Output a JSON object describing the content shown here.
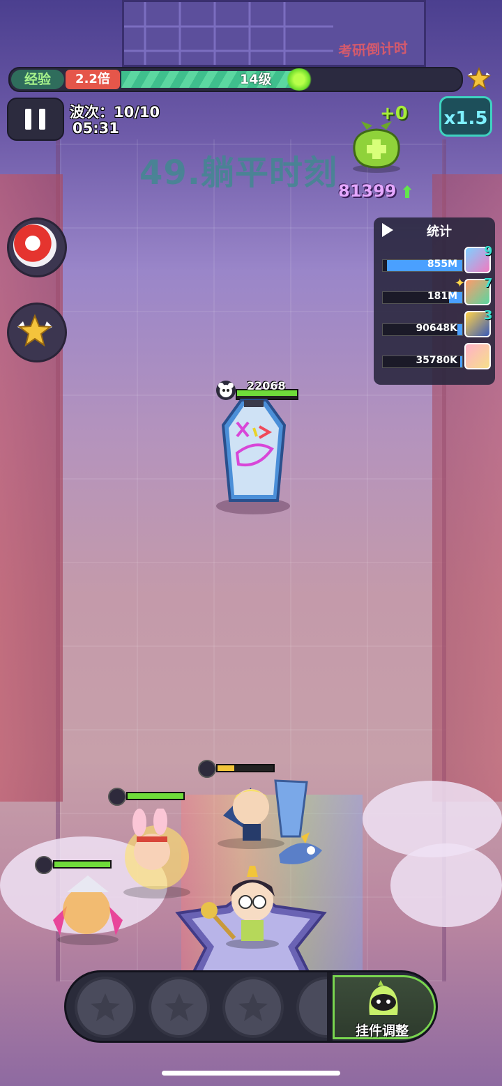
{
  "exp": {
    "label": "经验",
    "multiplier": "2.2倍",
    "level": "14级",
    "progress": 0.45
  },
  "wave": {
    "label": "波次：10/10",
    "time": "05:31"
  },
  "speed": {
    "label": "x1.5"
  },
  "reward": {
    "plus": "+0",
    "gold": "81399"
  },
  "stage_title": "49.躺平时刻",
  "board_text": "考研倒计时",
  "stats": {
    "title": "统计",
    "rows": [
      {
        "value": "855M",
        "count": "9",
        "fill": 0.95,
        "color": "#4aa0ff"
      },
      {
        "value": "181M",
        "count": "7",
        "fill": 0.17,
        "color": "#4aa0ff"
      },
      {
        "value": "90648K",
        "count": "3",
        "fill": 0.06,
        "color": "#4aa0ff"
      },
      {
        "value": "35780K",
        "count": "",
        "fill": 0.03,
        "color": "#4aa0ff"
      }
    ]
  },
  "boss": {
    "hp": "22068"
  },
  "dock": {
    "mount_label": "挂件调整"
  },
  "colors": {
    "accent": "#3ed2c0",
    "hp": "#6fdc3a",
    "exp": "#3fbf8d",
    "gold": "#e5a8ff"
  }
}
